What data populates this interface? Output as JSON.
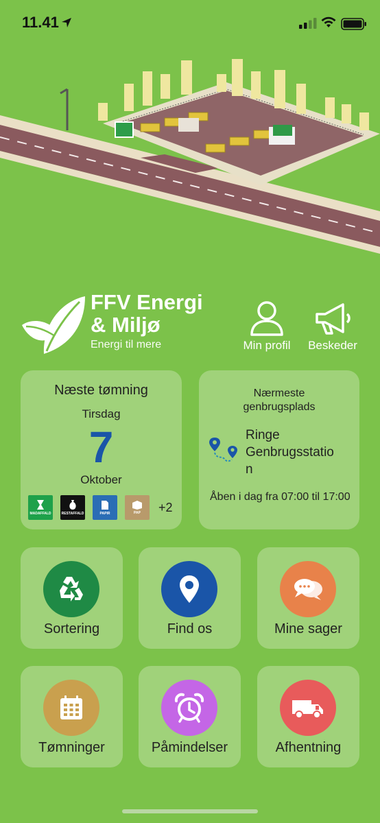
{
  "status": {
    "time": "11.41"
  },
  "brand": {
    "title": "FFV Energi\n& Miljø",
    "tagline": "Energi til mere"
  },
  "header_actions": [
    {
      "label": "Min profil",
      "icon": "person-icon"
    },
    {
      "label": "Beskeder",
      "icon": "megaphone-icon"
    }
  ],
  "next_collection": {
    "title": "Næste tømning",
    "weekday": "Tirsdag",
    "day": "7",
    "month": "Oktober",
    "bins": [
      {
        "label": "MADAFFALD",
        "color": "#1ea14a"
      },
      {
        "label": "RESTAFFALD",
        "color": "#111111"
      },
      {
        "label": "PAPIR",
        "color": "#2a6db5"
      },
      {
        "label": "PAP",
        "color": "#b89a6b"
      }
    ],
    "more": "+2"
  },
  "nearest_station": {
    "title": "Nærmeste\ngenbrugsplads",
    "name": "Ringe\nGenbrugsstatio\nn",
    "hours": "Åben i dag fra 07:00 til 17:00"
  },
  "tiles": [
    {
      "label": "Sortering",
      "icon": "recycle-icon",
      "color": "#1f8a45"
    },
    {
      "label": "Find os",
      "icon": "map-pin-icon",
      "color": "#1a55a8"
    },
    {
      "label": "Mine sager",
      "icon": "chat-bubbles-icon",
      "color": "#e8824a"
    },
    {
      "label": "Tømninger",
      "icon": "calendar-icon",
      "color": "#c9a04e"
    },
    {
      "label": "Påmindelser",
      "icon": "alarm-clock-icon",
      "color": "#c466e6"
    },
    {
      "label": "Afhentning",
      "icon": "truck-icon",
      "color": "#e85b5b"
    }
  ],
  "colors": {
    "background": "#7cc24a",
    "card": "#a0d27a",
    "accent_blue": "#1a55a8"
  }
}
